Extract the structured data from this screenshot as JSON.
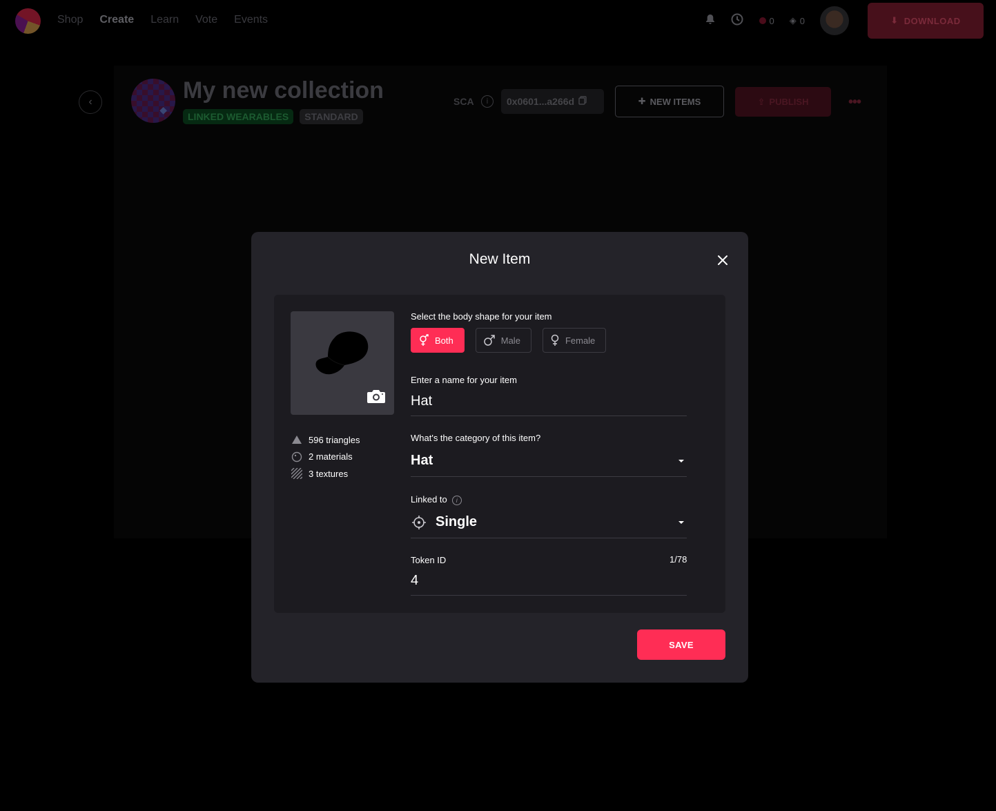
{
  "nav": {
    "links": [
      "Shop",
      "Create",
      "Learn",
      "Vote",
      "Events"
    ],
    "active_link": "Create",
    "mana_eth": "0",
    "mana_poly": "0",
    "download_label": "DOWNLOAD"
  },
  "collection": {
    "title": "My new collection",
    "tags": [
      "LINKED WEARABLES",
      "STANDARD"
    ],
    "sca_label": "SCA",
    "address": "0x0601...a266d",
    "new_items_label": "NEW ITEMS",
    "publish_label": "PUBLISH"
  },
  "modal": {
    "title": "New Item",
    "metrics": {
      "triangles": "596 triangles",
      "materials": "2 materials",
      "textures": "3 textures"
    },
    "body_shape": {
      "label": "Select the body shape for your item",
      "options": [
        "Both",
        "Male",
        "Female"
      ],
      "selected": "Both"
    },
    "name_field": {
      "label": "Enter a name for your item",
      "value": "Hat"
    },
    "category_field": {
      "label": "What's the category of this item?",
      "value": "Hat"
    },
    "linked_field": {
      "label": "Linked to",
      "value": "Single"
    },
    "token_field": {
      "label": "Token ID",
      "counter": "1/78",
      "value": "4"
    },
    "save_label": "SAVE"
  },
  "colors": {
    "accent": "#ff2d55",
    "modal_bg": "#242329",
    "modal_body_bg": "#1c1b20",
    "thumbnail_bg": "#3a3940"
  }
}
